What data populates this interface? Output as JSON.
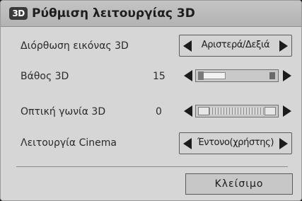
{
  "dialog": {
    "title": "Ρύθμιση λειτουργίας 3D",
    "badge": "3D"
  },
  "rows": {
    "correction": {
      "label": "Διόρθωση εικόνας 3D",
      "value": "Αριστερά/Δεξιά"
    },
    "depth": {
      "label": "Βάθος 3D",
      "value": "15",
      "level_fraction": 0.35
    },
    "viewpoint": {
      "label": "Οπτική γωνία 3D",
      "value": "0"
    },
    "cinema": {
      "label": "Λειτουργία Cinema",
      "value": "Έντονο(χρήστης)"
    }
  },
  "close_label": "Κλείσιμο",
  "colors": {
    "panel": "#d6d6d6",
    "titlebar": "#bcbcbc",
    "arrow": "#1b1b1b"
  }
}
